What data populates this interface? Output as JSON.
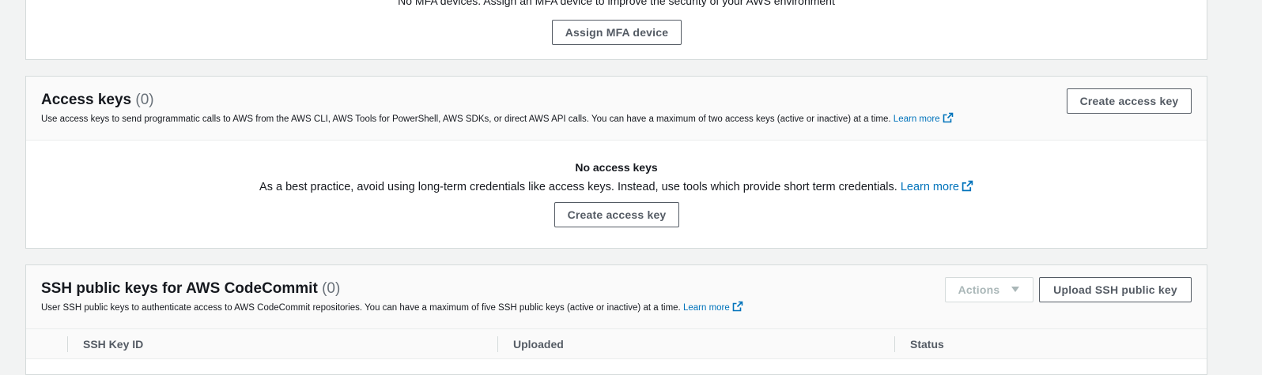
{
  "mfa": {
    "empty_text": "No MFA devices. Assign an MFA device to improve the security of your AWS environment",
    "assign_button": "Assign MFA device"
  },
  "access_keys": {
    "title": "Access keys",
    "count": "(0)",
    "description": "Use access keys to send programmatic calls to AWS from the AWS CLI, AWS Tools for PowerShell, AWS SDKs, or direct AWS API calls. You can have a maximum of two access keys (active or inactive) at a time.",
    "learn_more": "Learn more",
    "create_button": "Create access key",
    "empty_title": "No access keys",
    "empty_text": "As a best practice, avoid using long-term credentials like access keys. Instead, use tools which provide short term credentials.",
    "empty_learn_more": "Learn more",
    "empty_create_button": "Create access key"
  },
  "ssh": {
    "title": "SSH public keys for AWS CodeCommit",
    "count": "(0)",
    "description": "User SSH public keys to authenticate access to AWS CodeCommit repositories. You can have a maximum of five SSH public keys (active or inactive) at a time.",
    "learn_more": "Learn more",
    "actions_button": "Actions",
    "upload_button": "Upload SSH public key",
    "columns": [
      "SSH Key ID",
      "Uploaded",
      "Status"
    ]
  },
  "colors": {
    "link": "#0073bb",
    "border": "#d5dbdb",
    "header_bg": "#fafafa",
    "page_bg": "#f2f3f3"
  }
}
